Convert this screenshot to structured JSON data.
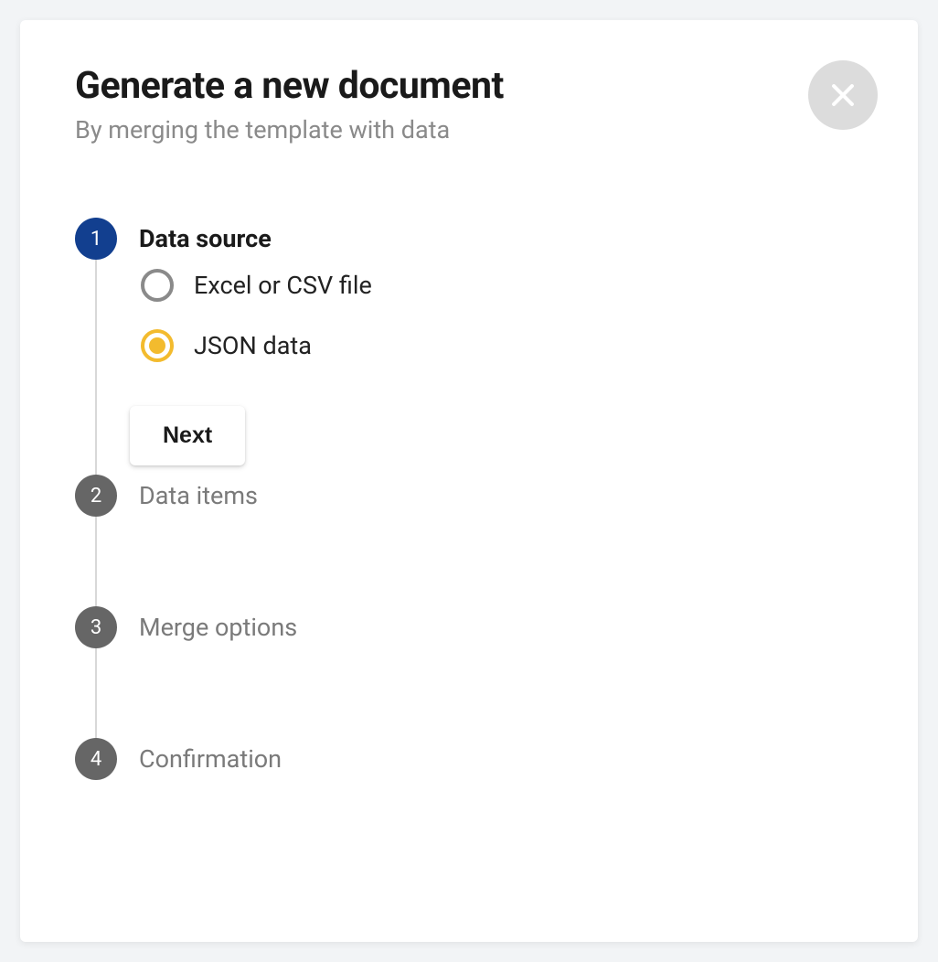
{
  "dialog": {
    "title": "Generate a new document",
    "subtitle": "By merging the template with data"
  },
  "steps": {
    "step1": {
      "number": "1",
      "label": "Data source",
      "options": {
        "excel": "Excel or CSV file",
        "json": "JSON data"
      },
      "next_button": "Next"
    },
    "step2": {
      "number": "2",
      "label": "Data items"
    },
    "step3": {
      "number": "3",
      "label": "Merge options"
    },
    "step4": {
      "number": "4",
      "label": "Confirmation"
    }
  }
}
